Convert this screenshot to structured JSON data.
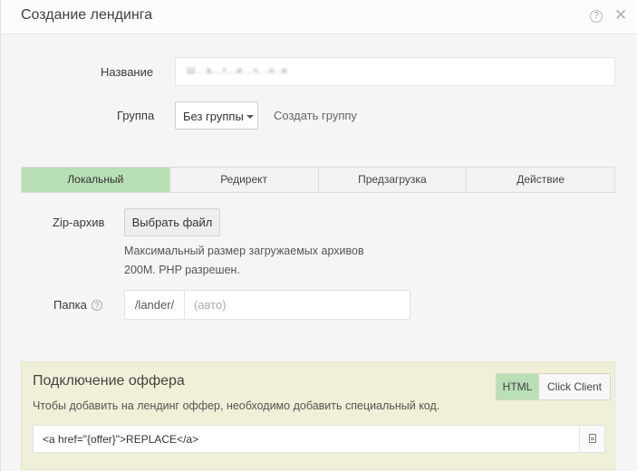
{
  "header": {
    "title": "Создание лендинга",
    "help_icon": "question-circle-icon",
    "help_glyph": "?",
    "close_icon": "close-icon",
    "close_glyph": "✕"
  },
  "form": {
    "name_label": "Название",
    "name_value": "Ш...а...т...и...ч...н..и",
    "group_label": "Группа",
    "group_selected": "Без группы",
    "create_group_link": "Создать группу"
  },
  "tabs": [
    {
      "label": "Локальный",
      "active": true
    },
    {
      "label": "Редирект",
      "active": false
    },
    {
      "label": "Предзагрузка",
      "active": false
    },
    {
      "label": "Действие",
      "active": false
    }
  ],
  "local": {
    "zip_label": "Zip-архив",
    "file_button": "Выбрать файл",
    "hint_line1": "Максимальный размер загружаемых архивов",
    "hint_line2": "200M. PHP разрешен.",
    "folder_label": "Папка",
    "folder_help_glyph": "?",
    "folder_prefix": "/lander/",
    "folder_placeholder": "(авто)"
  },
  "offer": {
    "title": "Подключение оффера",
    "toggle": [
      {
        "label": "HTML",
        "active": true
      },
      {
        "label": "Click Client",
        "active": false
      }
    ],
    "description": "Чтобы добавить на лендинг оффер, необходимо добавить специальный код.",
    "code": "<a href=\"{offer}\">REPLACE</a>",
    "copy_icon": "copy-icon"
  },
  "colors": {
    "accent_green": "#b8dfb6",
    "offer_panel_bg": "#f0f0d8",
    "body_bg": "#f5f5f5"
  }
}
